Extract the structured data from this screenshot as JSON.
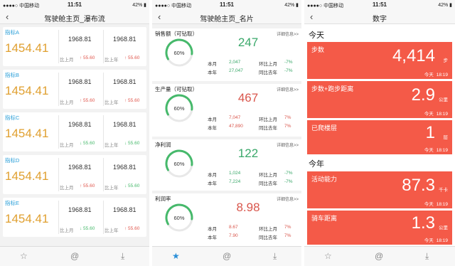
{
  "status": {
    "carrier": "中国移动",
    "signal": "●●●●○",
    "time": "11:51",
    "battery": "42% ▮"
  },
  "panel1": {
    "title": "驾驶舱主页_瀑布流",
    "cards": [
      {
        "name": "指标A",
        "big": "1454.41",
        "v1": "1968.81",
        "v2": "1968.81",
        "l1": "比上月",
        "c1": "↑ 55.60",
        "d1": "up",
        "l2": "比上年",
        "c2": "↑ 55.60",
        "d2": "up"
      },
      {
        "name": "指标B",
        "big": "1454.41",
        "v1": "1968.81",
        "v2": "1968.81",
        "l1": "比上月",
        "c1": "↑ 55.60",
        "d1": "up",
        "l2": "比上年",
        "c2": "↑ 55.60",
        "d2": "up"
      },
      {
        "name": "指标C",
        "big": "1454.41",
        "v1": "1968.81",
        "v2": "1968.81",
        "l1": "比上月",
        "c1": "↓ 55.60",
        "d1": "down",
        "l2": "比上年",
        "c2": "↓ 55.60",
        "d2": "down"
      },
      {
        "name": "指标D",
        "big": "1454.41",
        "v1": "1968.81",
        "v2": "1968.81",
        "l1": "比上月",
        "c1": "↑ 55.60",
        "d1": "up",
        "l2": "比上年",
        "c2": "↓ 55.60",
        "d2": "down"
      },
      {
        "name": "指标E",
        "big": "1454.41",
        "v1": "1968.81",
        "v2": "1968.81",
        "l1": "比上月",
        "c1": "↓ 55.60",
        "d1": "down",
        "l2": "比上年",
        "c2": "↑ 55.60",
        "d2": "up"
      }
    ]
  },
  "panel2": {
    "title": "驾驶舱主页_名片",
    "more": "详细信息>>",
    "cards": [
      {
        "name": "销售额（可钻取）",
        "big": "247",
        "bigColor": "#3aa86a",
        "pct": "60%",
        "month": "本月",
        "monthVal": "2,047",
        "year": "本年",
        "yearVal": "27,047",
        "valColor": "#3aa86a",
        "mom": "环比上月",
        "momVal": "-7%",
        "yoy": "同比去年",
        "yoyVal": "-7%",
        "chgColor": "#3aa86a",
        "showMore": true
      },
      {
        "name": "生产量（可钻取）",
        "big": "467",
        "bigColor": "#d9564c",
        "pct": "60%",
        "month": "本月",
        "monthVal": "7,047",
        "year": "本年",
        "yearVal": "47,890",
        "valColor": "#d9564c",
        "mom": "环比上月",
        "momVal": "7%",
        "yoy": "同比去年",
        "yoyVal": "7%",
        "chgColor": "#d9564c",
        "showMore": true
      },
      {
        "name": "净利润",
        "big": "122",
        "bigColor": "#3aa86a",
        "pct": "60%",
        "month": "本月",
        "monthVal": "1,024",
        "year": "本年",
        "yearVal": "7,224",
        "valColor": "#3aa86a",
        "mom": "环比上月",
        "momVal": "-7%",
        "yoy": "同比去年",
        "yoyVal": "-7%",
        "chgColor": "#3aa86a",
        "showMore": true
      },
      {
        "name": "利润率",
        "big": "8.98",
        "bigColor": "#d9564c",
        "pct": "60%",
        "month": "本月",
        "monthVal": "8.67",
        "year": "本年",
        "yearVal": "7.90",
        "valColor": "#d9564c",
        "mom": "环比上月",
        "momVal": "7%",
        "yoy": "同比去年",
        "yoyVal": "7%",
        "chgColor": "#d9564c",
        "showMore": true
      }
    ],
    "gaugeFraction": 0.6,
    "gaugeColor": "#46b96b"
  },
  "panel3": {
    "title": "数字",
    "today": "今天",
    "year": "今年",
    "cards": [
      {
        "name": "步数",
        "value": "4,414",
        "unit": "步",
        "day": "今天",
        "time": "18:19"
      },
      {
        "name": "步数+跑步距离",
        "value": "2.9",
        "unit": "公里",
        "day": "今天",
        "time": "18:19"
      },
      {
        "name": "已爬楼层",
        "value": "1",
        "unit": "层",
        "day": "今天",
        "time": "18:19"
      },
      {
        "name": "活动能力",
        "value": "87.3",
        "unit": "千卡",
        "day": "今天",
        "time": "18:19"
      },
      {
        "name": "骑车距离",
        "value": "1.3",
        "unit": "公里",
        "day": "今天",
        "time": "18:19"
      }
    ],
    "cardColor": "#f45a48"
  },
  "tabs": {
    "star": "☆",
    "starActive": "★",
    "at": "@",
    "download": "⤓"
  }
}
